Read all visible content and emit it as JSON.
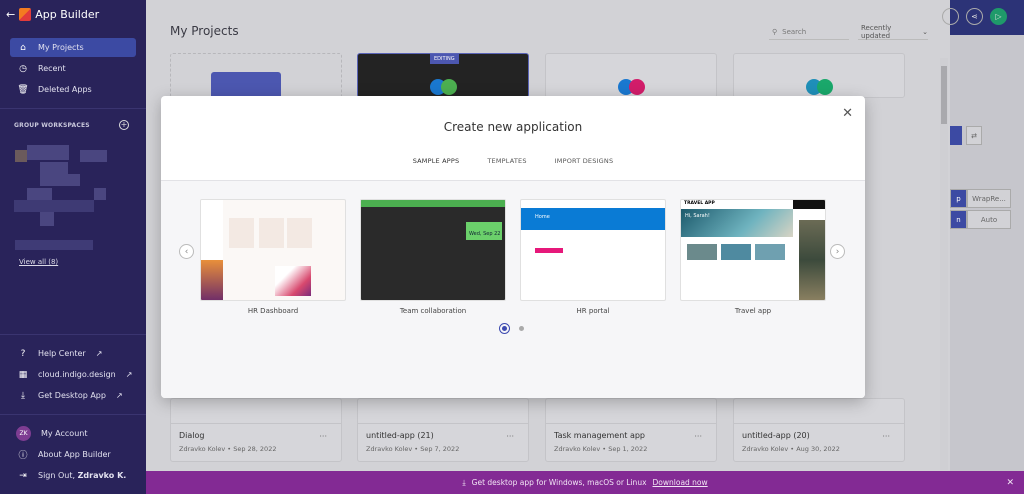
{
  "app": {
    "title": "App Builder",
    "back_icon": "arrow-left-icon"
  },
  "sidebar": {
    "items": [
      {
        "label": "My Projects",
        "icon": "home-icon",
        "active": true
      },
      {
        "label": "Recent",
        "icon": "clock-icon"
      },
      {
        "label": "Deleted Apps",
        "icon": "trash-icon"
      }
    ],
    "group_workspaces": "GROUP WORKSPACES",
    "view_all": "View all (8)",
    "links": [
      {
        "label": "Help Center",
        "icon": "help-icon"
      },
      {
        "label": "cloud.indigo.design",
        "icon": "grid-icon"
      },
      {
        "label": "Get Desktop App",
        "icon": "download-icon"
      }
    ],
    "account": {
      "initials": "ZK",
      "my_account": "My Account",
      "about": "About App Builder",
      "sign_out": "Sign Out,",
      "user": "Zdravko K."
    }
  },
  "main": {
    "title": "My Projects",
    "search_placeholder": "Search",
    "sort": "Recently updated",
    "editing_badge": "EDITING",
    "projects": [
      {
        "title": "Dialog",
        "author": "Zdravko Kolev",
        "date": "Sep 28, 2022"
      },
      {
        "title": "untitled-app (21)",
        "author": "Zdravko Kolev",
        "date": "Sep 7, 2022"
      },
      {
        "title": "Task management app",
        "author": "Zdravko Kolev",
        "date": "Sep 1, 2022"
      },
      {
        "title": "untitled-app (20)",
        "author": "Zdravko Kolev",
        "date": "Aug 30, 2022"
      }
    ],
    "more": "···"
  },
  "right_panel": {
    "wrap_label": "WrapRe...",
    "auto_label": "Auto"
  },
  "modal": {
    "title": "Create new application",
    "tabs": [
      {
        "label": "SAMPLE APPS",
        "active": true
      },
      {
        "label": "TEMPLATES"
      },
      {
        "label": "IMPORT DESIGNS"
      }
    ],
    "samples": [
      {
        "label": "HR Dashboard"
      },
      {
        "label": "Team collaboration"
      },
      {
        "label": "HR portal"
      },
      {
        "label": "Travel app"
      }
    ],
    "thumb_text": {
      "team_date": "Wed, Sep 22",
      "portal_home": "Home",
      "travel_title": "TRAVEL APP",
      "travel_greeting": "Hi, Sarah!"
    },
    "page": 1,
    "pages": 2
  },
  "banner": {
    "text": "Get desktop app for Windows, macOS or Linux",
    "link": "Download now"
  },
  "colors": {
    "sidebar": "#29235a",
    "accent": "#3c4aa3",
    "banner": "#832a94"
  }
}
